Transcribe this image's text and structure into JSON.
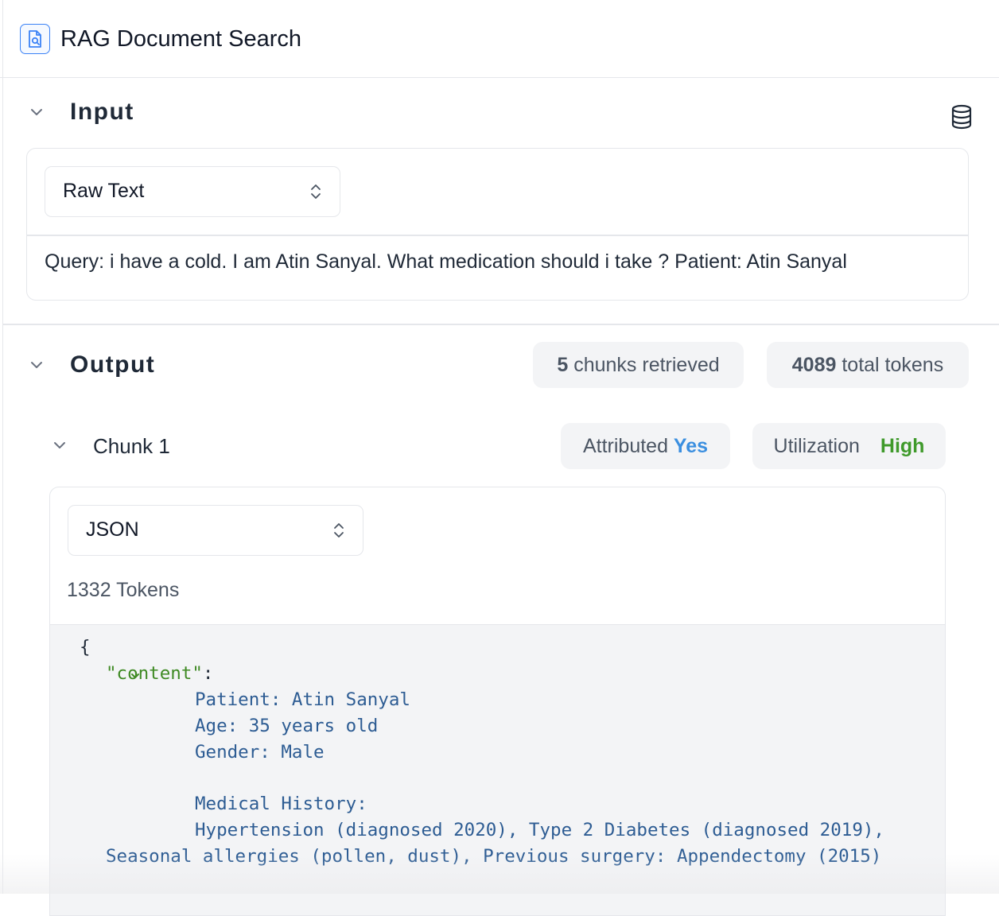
{
  "header": {
    "title": "RAG Document Search",
    "icon": "document-search-icon"
  },
  "input": {
    "title": "Input",
    "format_select": "Raw Text",
    "query_text": "Query: i have a cold. I am Atin Sanyal. What medication should i take ? Patient: Atin Sanyal"
  },
  "output": {
    "title": "Output",
    "chunks_count": "5",
    "chunks_label": " chunks retrieved",
    "tokens_count": "4089",
    "tokens_label": " total tokens"
  },
  "chunk": {
    "title": "Chunk 1",
    "attributed_label": "Attributed ",
    "attributed_value": "Yes",
    "utilization_label": "Utilization",
    "utilization_value": "High",
    "format_select": "JSON",
    "token_count": "1332 Tokens",
    "json_open": "{",
    "json_key": "\"content\"",
    "json_colon": ":",
    "content_lines": [
      "Patient: Atin Sanyal",
      "Age: 35 years old",
      "Gender: Male",
      "",
      "Medical History:",
      "Hypertension (diagnosed 2020), Type 2 Diabetes (diagnosed 2019),",
      "Seasonal allergies (pollen, dust), Previous surgery: Appendectomy (2015)"
    ]
  },
  "colors": {
    "accent_blue": "#3b8fe0",
    "high_green": "#3f9a2b",
    "json_key_green": "#3f8a24",
    "json_value_blue": "#2d5c93"
  }
}
